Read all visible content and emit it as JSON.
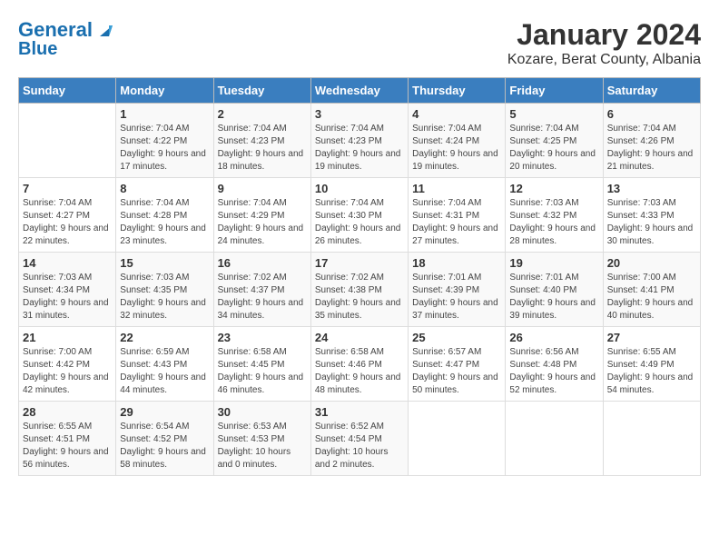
{
  "logo": {
    "line1": "General",
    "line2": "Blue"
  },
  "title": "January 2024",
  "subtitle": "Kozare, Berat County, Albania",
  "days": [
    "Sunday",
    "Monday",
    "Tuesday",
    "Wednesday",
    "Thursday",
    "Friday",
    "Saturday"
  ],
  "weeks": [
    [
      {
        "date": "",
        "sunrise": "",
        "sunset": "",
        "daylight": ""
      },
      {
        "date": "1",
        "sunrise": "Sunrise: 7:04 AM",
        "sunset": "Sunset: 4:22 PM",
        "daylight": "Daylight: 9 hours and 17 minutes."
      },
      {
        "date": "2",
        "sunrise": "Sunrise: 7:04 AM",
        "sunset": "Sunset: 4:23 PM",
        "daylight": "Daylight: 9 hours and 18 minutes."
      },
      {
        "date": "3",
        "sunrise": "Sunrise: 7:04 AM",
        "sunset": "Sunset: 4:23 PM",
        "daylight": "Daylight: 9 hours and 19 minutes."
      },
      {
        "date": "4",
        "sunrise": "Sunrise: 7:04 AM",
        "sunset": "Sunset: 4:24 PM",
        "daylight": "Daylight: 9 hours and 19 minutes."
      },
      {
        "date": "5",
        "sunrise": "Sunrise: 7:04 AM",
        "sunset": "Sunset: 4:25 PM",
        "daylight": "Daylight: 9 hours and 20 minutes."
      },
      {
        "date": "6",
        "sunrise": "Sunrise: 7:04 AM",
        "sunset": "Sunset: 4:26 PM",
        "daylight": "Daylight: 9 hours and 21 minutes."
      }
    ],
    [
      {
        "date": "7",
        "sunrise": "Sunrise: 7:04 AM",
        "sunset": "Sunset: 4:27 PM",
        "daylight": "Daylight: 9 hours and 22 minutes."
      },
      {
        "date": "8",
        "sunrise": "Sunrise: 7:04 AM",
        "sunset": "Sunset: 4:28 PM",
        "daylight": "Daylight: 9 hours and 23 minutes."
      },
      {
        "date": "9",
        "sunrise": "Sunrise: 7:04 AM",
        "sunset": "Sunset: 4:29 PM",
        "daylight": "Daylight: 9 hours and 24 minutes."
      },
      {
        "date": "10",
        "sunrise": "Sunrise: 7:04 AM",
        "sunset": "Sunset: 4:30 PM",
        "daylight": "Daylight: 9 hours and 26 minutes."
      },
      {
        "date": "11",
        "sunrise": "Sunrise: 7:04 AM",
        "sunset": "Sunset: 4:31 PM",
        "daylight": "Daylight: 9 hours and 27 minutes."
      },
      {
        "date": "12",
        "sunrise": "Sunrise: 7:03 AM",
        "sunset": "Sunset: 4:32 PM",
        "daylight": "Daylight: 9 hours and 28 minutes."
      },
      {
        "date": "13",
        "sunrise": "Sunrise: 7:03 AM",
        "sunset": "Sunset: 4:33 PM",
        "daylight": "Daylight: 9 hours and 30 minutes."
      }
    ],
    [
      {
        "date": "14",
        "sunrise": "Sunrise: 7:03 AM",
        "sunset": "Sunset: 4:34 PM",
        "daylight": "Daylight: 9 hours and 31 minutes."
      },
      {
        "date": "15",
        "sunrise": "Sunrise: 7:03 AM",
        "sunset": "Sunset: 4:35 PM",
        "daylight": "Daylight: 9 hours and 32 minutes."
      },
      {
        "date": "16",
        "sunrise": "Sunrise: 7:02 AM",
        "sunset": "Sunset: 4:37 PM",
        "daylight": "Daylight: 9 hours and 34 minutes."
      },
      {
        "date": "17",
        "sunrise": "Sunrise: 7:02 AM",
        "sunset": "Sunset: 4:38 PM",
        "daylight": "Daylight: 9 hours and 35 minutes."
      },
      {
        "date": "18",
        "sunrise": "Sunrise: 7:01 AM",
        "sunset": "Sunset: 4:39 PM",
        "daylight": "Daylight: 9 hours and 37 minutes."
      },
      {
        "date": "19",
        "sunrise": "Sunrise: 7:01 AM",
        "sunset": "Sunset: 4:40 PM",
        "daylight": "Daylight: 9 hours and 39 minutes."
      },
      {
        "date": "20",
        "sunrise": "Sunrise: 7:00 AM",
        "sunset": "Sunset: 4:41 PM",
        "daylight": "Daylight: 9 hours and 40 minutes."
      }
    ],
    [
      {
        "date": "21",
        "sunrise": "Sunrise: 7:00 AM",
        "sunset": "Sunset: 4:42 PM",
        "daylight": "Daylight: 9 hours and 42 minutes."
      },
      {
        "date": "22",
        "sunrise": "Sunrise: 6:59 AM",
        "sunset": "Sunset: 4:43 PM",
        "daylight": "Daylight: 9 hours and 44 minutes."
      },
      {
        "date": "23",
        "sunrise": "Sunrise: 6:58 AM",
        "sunset": "Sunset: 4:45 PM",
        "daylight": "Daylight: 9 hours and 46 minutes."
      },
      {
        "date": "24",
        "sunrise": "Sunrise: 6:58 AM",
        "sunset": "Sunset: 4:46 PM",
        "daylight": "Daylight: 9 hours and 48 minutes."
      },
      {
        "date": "25",
        "sunrise": "Sunrise: 6:57 AM",
        "sunset": "Sunset: 4:47 PM",
        "daylight": "Daylight: 9 hours and 50 minutes."
      },
      {
        "date": "26",
        "sunrise": "Sunrise: 6:56 AM",
        "sunset": "Sunset: 4:48 PM",
        "daylight": "Daylight: 9 hours and 52 minutes."
      },
      {
        "date": "27",
        "sunrise": "Sunrise: 6:55 AM",
        "sunset": "Sunset: 4:49 PM",
        "daylight": "Daylight: 9 hours and 54 minutes."
      }
    ],
    [
      {
        "date": "28",
        "sunrise": "Sunrise: 6:55 AM",
        "sunset": "Sunset: 4:51 PM",
        "daylight": "Daylight: 9 hours and 56 minutes."
      },
      {
        "date": "29",
        "sunrise": "Sunrise: 6:54 AM",
        "sunset": "Sunset: 4:52 PM",
        "daylight": "Daylight: 9 hours and 58 minutes."
      },
      {
        "date": "30",
        "sunrise": "Sunrise: 6:53 AM",
        "sunset": "Sunset: 4:53 PM",
        "daylight": "Daylight: 10 hours and 0 minutes."
      },
      {
        "date": "31",
        "sunrise": "Sunrise: 6:52 AM",
        "sunset": "Sunset: 4:54 PM",
        "daylight": "Daylight: 10 hours and 2 minutes."
      },
      {
        "date": "",
        "sunrise": "",
        "sunset": "",
        "daylight": ""
      },
      {
        "date": "",
        "sunrise": "",
        "sunset": "",
        "daylight": ""
      },
      {
        "date": "",
        "sunrise": "",
        "sunset": "",
        "daylight": ""
      }
    ]
  ]
}
